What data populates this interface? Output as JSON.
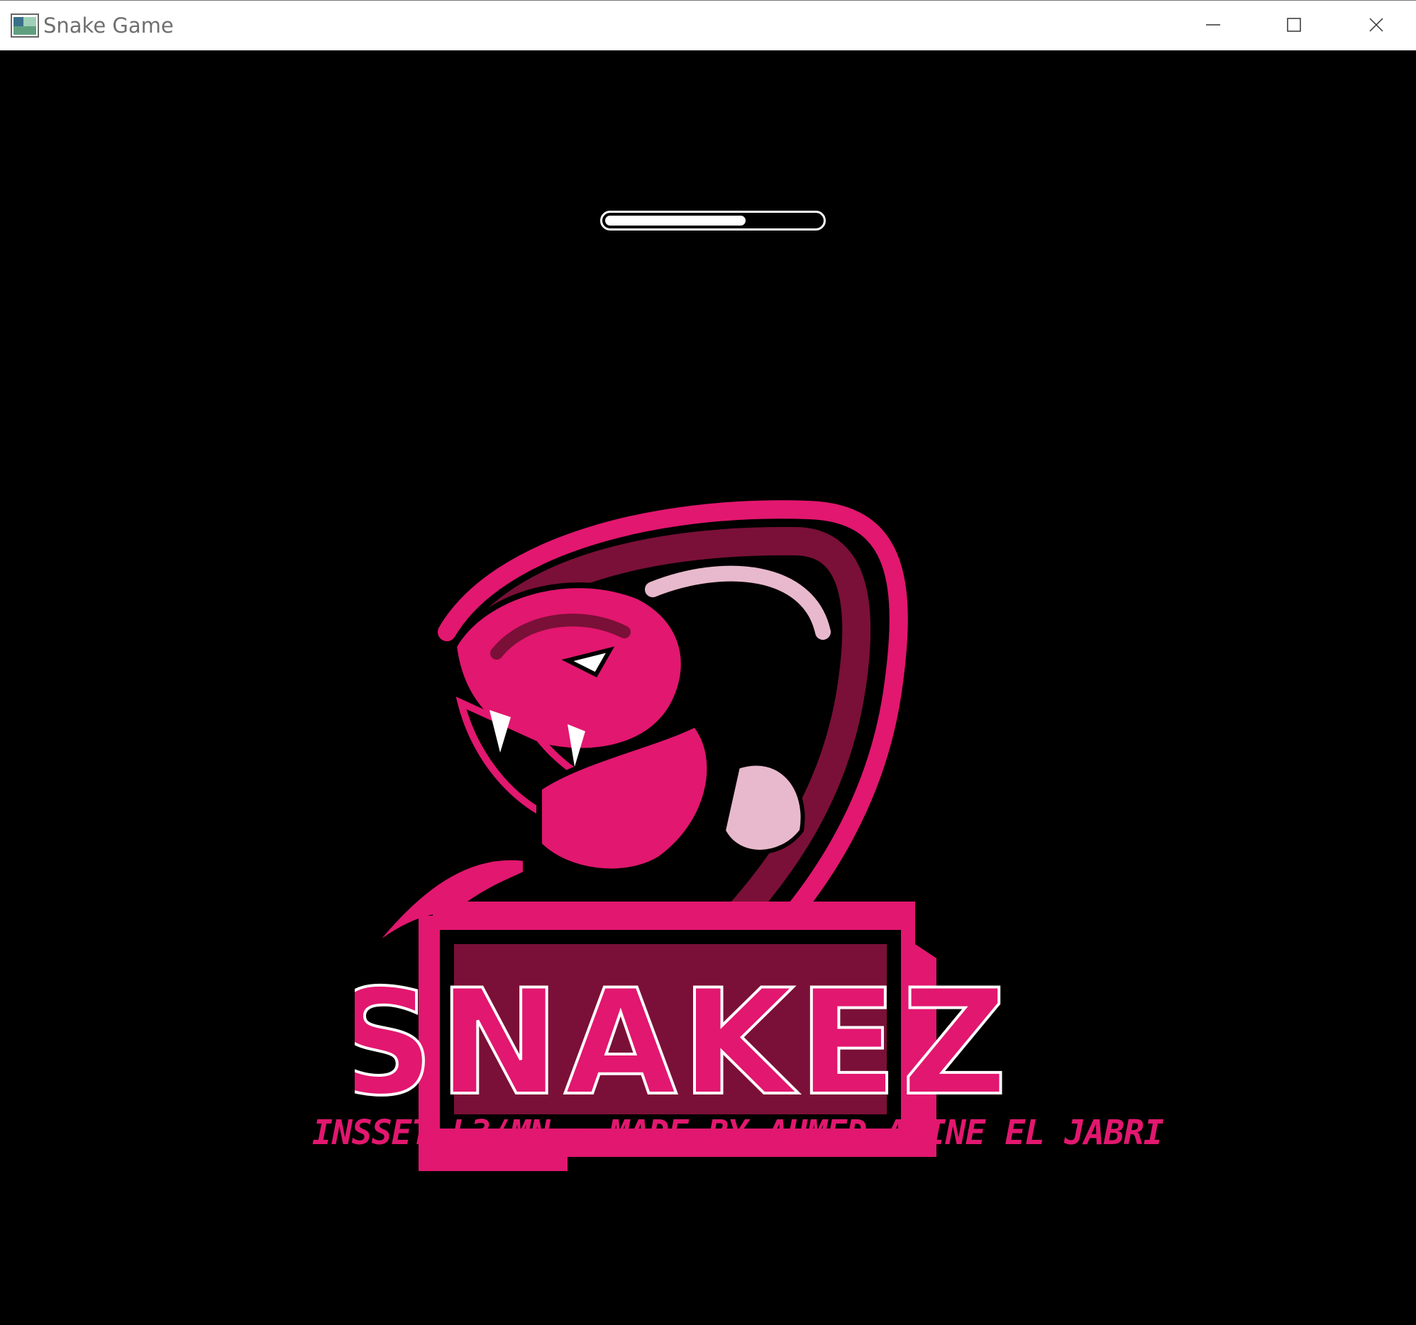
{
  "window": {
    "title": "Snake Game",
    "icon": "app-window-icon",
    "controls": {
      "minimize": "minimize-icon",
      "maximize": "maximize-icon",
      "close": "close-icon"
    }
  },
  "loading": {
    "progress": 0.65
  },
  "logo": {
    "wordmark": "SNAKEZ"
  },
  "footer": {
    "credit": "INSSET L3/MN - MADE BY AHMED-AMINE EL JABRI"
  },
  "colors": {
    "background": "#000000",
    "accent": "#e2176f",
    "accent_dark": "#7a1037",
    "accent_light": "#e8b9cc"
  }
}
